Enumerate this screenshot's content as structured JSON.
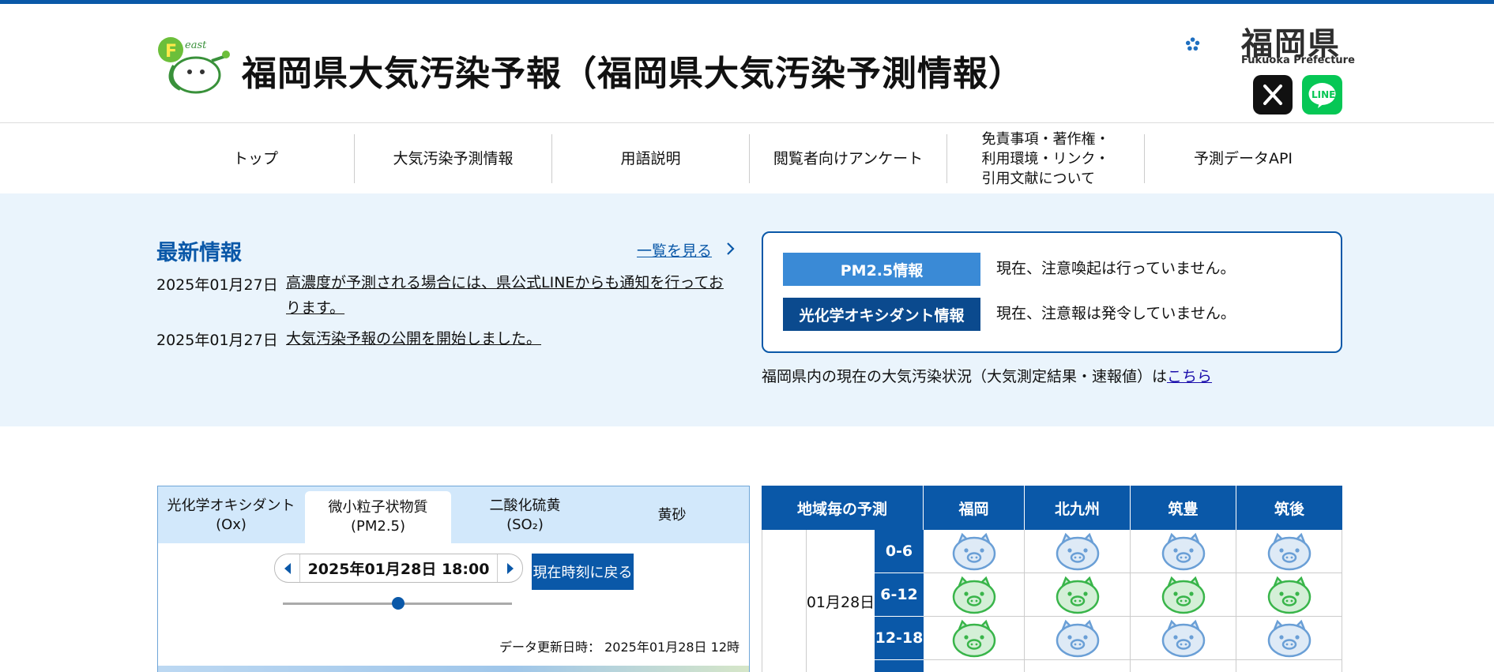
{
  "header": {
    "site_title": "福岡県大気汚染予報（福岡県大気汚染予測情報）",
    "pref_name": "福岡県",
    "pref_name_en": "Fukuoka Prefecture"
  },
  "nav": [
    {
      "label": "トップ"
    },
    {
      "label": "大気汚染予測情報"
    },
    {
      "label": "用語説明"
    },
    {
      "label": "閲覧者向けアンケート"
    },
    {
      "label": "免責事項・著作権・\n利用環境・リンク・\n引用文献について"
    },
    {
      "label": "予測データAPI"
    }
  ],
  "news": {
    "title": "最新情報",
    "more_label": "一覧を見る",
    "items": [
      {
        "date": "2025年01月27日",
        "text": "高濃度が予測される場合には、県公式LINEからも通知を行っております。"
      },
      {
        "date": "2025年01月27日",
        "text": "大気汚染予報の公開を開始しました。"
      }
    ]
  },
  "alerts": [
    {
      "tag": "PM2.5情報",
      "message": "現在、注意喚起は行っていません。",
      "color": "#3a8ad6"
    },
    {
      "tag": "光化学オキシダント情報",
      "message": "現在、注意報は発令していません。",
      "color": "#0b4a8e"
    }
  ],
  "status_note": {
    "text": "福岡県内の現在の大気汚染状況（大気測定結果・速報値）は",
    "link": "こちら"
  },
  "forecast_panel": {
    "tabs": [
      {
        "line1": "光化学オキシダント",
        "line2": "(Ox)",
        "active": false
      },
      {
        "line1": "微小粒子状物質",
        "line2": "(PM2.5)",
        "active": true
      },
      {
        "line1": "二酸化硫黄",
        "line2": "(SO₂)",
        "active": false
      },
      {
        "line1": "黄砂",
        "line2": "",
        "active": false
      }
    ],
    "current_datetime": "2025年01月28日 18:00",
    "now_button": "現在時刻に戻る",
    "slider_position": 0.41,
    "updated_label": "データ更新日時：",
    "updated_value": "2025年01月28日 12時"
  },
  "region_table": {
    "header": [
      "地域毎の予測",
      "福岡",
      "北九州",
      "筑豊",
      "筑後"
    ],
    "date": "01月28日",
    "slots": [
      {
        "label": "0-6",
        "levels": [
          "blue",
          "blue",
          "blue",
          "blue"
        ]
      },
      {
        "label": "6-12",
        "levels": [
          "green",
          "green",
          "green",
          "green"
        ]
      },
      {
        "label": "12-18",
        "levels": [
          "green",
          "blue",
          "blue",
          "blue"
        ]
      }
    ],
    "icon_colors": {
      "blue": "#6a9fd6",
      "green": "#39b54a"
    }
  },
  "colors": {
    "brand": "#0a58a8",
    "band_background": "#eaf4fc",
    "line_green": "#06c755"
  }
}
